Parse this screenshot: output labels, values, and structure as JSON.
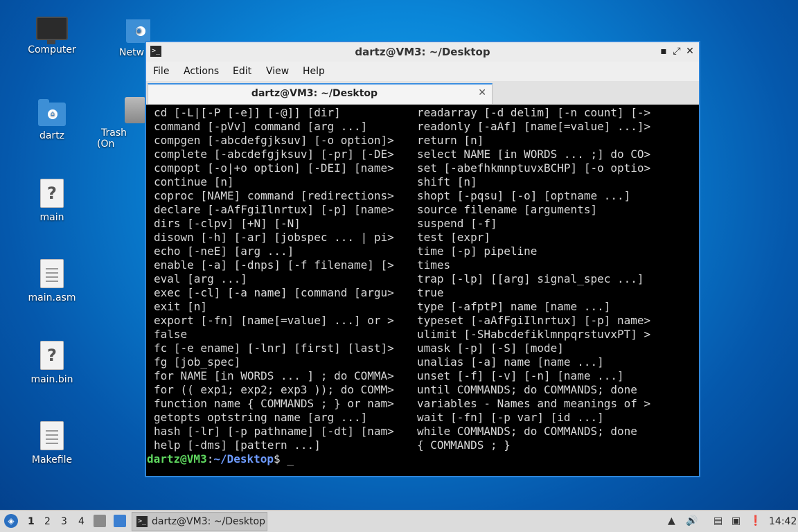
{
  "desktop": {
    "icons": [
      {
        "label": "Computer",
        "icon": "computer-icon"
      },
      {
        "label": "Netw",
        "icon": "network-folder-icon"
      },
      {
        "label": "dartz",
        "icon": "home-folder-icon"
      },
      {
        "label": "Trash (On",
        "icon": "trash-icon"
      },
      {
        "label": "main",
        "icon": "unknown-file-icon"
      },
      {
        "label": "main.asm",
        "icon": "text-file-icon"
      },
      {
        "label": "main.bin",
        "icon": "unknown-file-icon"
      },
      {
        "label": "Makefile",
        "icon": "text-file-icon"
      }
    ]
  },
  "window": {
    "title": "dartz@VM3: ~/Desktop",
    "menu": [
      "File",
      "Actions",
      "Edit",
      "View",
      "Help"
    ],
    "tab_label": "dartz@VM3: ~/Desktop",
    "tab_close": "✕",
    "controls": {
      "minimize": "▪",
      "maximize": "⤢",
      "close": "✕"
    }
  },
  "terminal": {
    "left_column": [
      "cd [-L|[-P [-e]] [-@]] [dir]",
      "command [-pVv] command [arg ...]",
      "compgen [-abcdefgjksuv] [-o option]>",
      "complete [-abcdefgjksuv] [-pr] [-DE>",
      "compopt [-o|+o option] [-DEI] [name>",
      "continue [n]",
      "coproc [NAME] command [redirections>",
      "declare [-aAfFgiIlnrtux] [-p] [name>",
      "dirs [-clpv] [+N] [-N]",
      "disown [-h] [-ar] [jobspec ... | pi>",
      "echo [-neE] [arg ...]",
      "enable [-a] [-dnps] [-f filename] [>",
      "eval [arg ...]",
      "exec [-cl] [-a name] [command [argu>",
      "exit [n]",
      "export [-fn] [name[=value] ...] or >",
      "false",
      "fc [-e ename] [-lnr] [first] [last]>",
      "fg [job_spec]",
      "for NAME [in WORDS ... ] ; do COMMA>",
      "for (( exp1; exp2; exp3 )); do COMM>",
      "function name { COMMANDS ; } or nam>",
      "getopts optstring name [arg ...]",
      "hash [-lr] [-p pathname] [-dt] [nam>",
      "help [-dms] [pattern ...]"
    ],
    "right_column": [
      "readarray [-d delim] [-n count] [->",
      "readonly [-aAf] [name[=value] ...]>",
      "return [n]",
      "select NAME [in WORDS ... ;] do CO>",
      "set [-abefhkmnptuvxBCHP] [-o optio>",
      "shift [n]",
      "shopt [-pqsu] [-o] [optname ...]",
      "source filename [arguments]",
      "suspend [-f]",
      "test [expr]",
      "time [-p] pipeline",
      "times",
      "trap [-lp] [[arg] signal_spec ...]",
      "true",
      "type [-afptP] name [name ...]",
      "typeset [-aAfFgiIlnrtux] [-p] name>",
      "ulimit [-SHabcdefiklmnpqrstuvxPT] >",
      "umask [-p] [-S] [mode]",
      "unalias [-a] name [name ...]",
      "unset [-f] [-v] [-n] [name ...]",
      "until COMMANDS; do COMMANDS; done",
      "variables - Names and meanings of >",
      "wait [-fn] [-p var] [id ...]",
      "while COMMANDS; do COMMANDS; done",
      "{ COMMANDS ; }"
    ],
    "prompt_user": "dartz@VM3",
    "prompt_sep": ":",
    "prompt_path": "~/Desktop",
    "prompt_dollar": "$ ",
    "cursor": "_"
  },
  "taskbar": {
    "workspaces": [
      "1",
      "2",
      "3",
      "4"
    ],
    "task_label": "dartz@VM3: ~/Desktop",
    "clock": "14:42"
  }
}
